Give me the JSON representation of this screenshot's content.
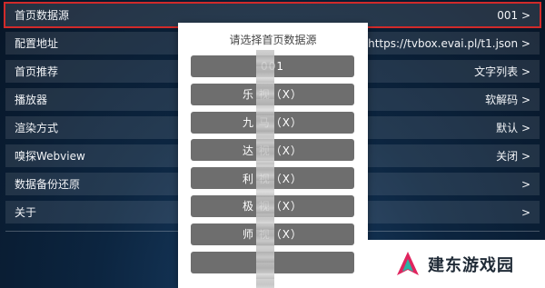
{
  "settings": {
    "rows": [
      {
        "label": "首页数据源",
        "value": "001 >"
      },
      {
        "label": "配置地址",
        "value": "https://tvbox.evai.pl/t1.json >"
      },
      {
        "label": "首页推荐",
        "value": "文字列表 >"
      },
      {
        "label": "播放器",
        "value": "软解码 >"
      },
      {
        "label": "渲染方式",
        "value": "默认 >"
      },
      {
        "label": "嗅探Webview",
        "value": "关闭 >"
      },
      {
        "label": "数据备份还原",
        "value": ">"
      },
      {
        "label": "关于",
        "value": ">"
      }
    ]
  },
  "dialog": {
    "title": "请选择首页数据源",
    "options": [
      "001",
      "乐 视（X）",
      "九 马（X）",
      "达 视（X）",
      "利 视（X）",
      "极 视（X）",
      "师 视（X）",
      ""
    ]
  },
  "watermark": {
    "text": "建东游戏园",
    "colors": {
      "logo_primary": "#e0245e",
      "logo_secondary": "#2bb3a3"
    }
  }
}
